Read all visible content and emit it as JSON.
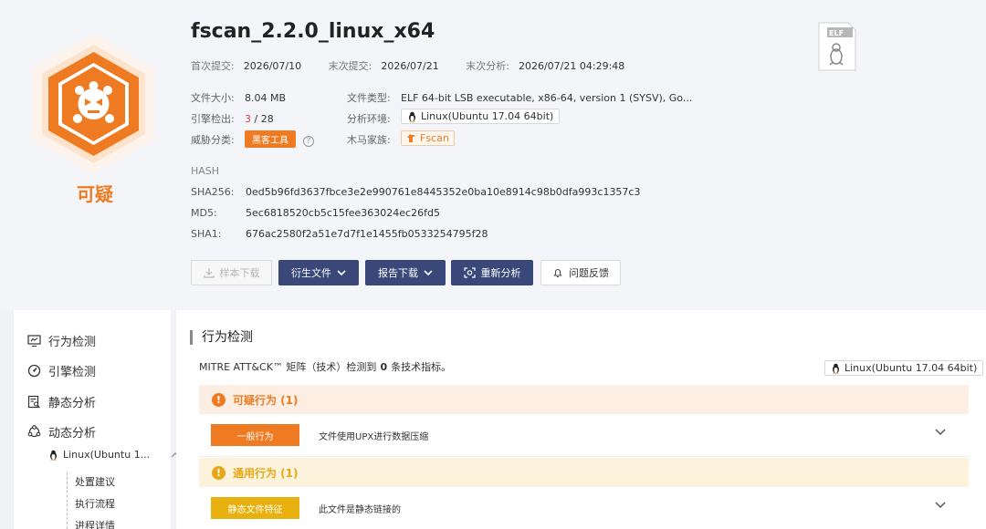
{
  "verdict": {
    "label": "可疑",
    "color": "#ee7b22"
  },
  "file": {
    "name": "fscan_2.2.0_linux_x64",
    "dates": [
      {
        "label": "首次提交:",
        "value": "2026/07/10"
      },
      {
        "label": "末次提交:",
        "value": "2026/07/21"
      },
      {
        "label": "末次分析:",
        "value": "2026/07/21 04:29:48"
      }
    ],
    "size_label": "文件大小:",
    "size": "8.04 MB",
    "engine_label": "引擎检出:",
    "engine_hits": "3",
    "engine_total": "/ 28",
    "threat_label": "威胁分类:",
    "threat_tag": "黑客工具",
    "type_label": "文件类型:",
    "type": "ELF 64-bit LSB executable, x86-64, version 1 (SYSV), Go...",
    "env_label": "分析环境:",
    "env": "Linux(Ubuntu 17.04 64bit)",
    "family_label": "木马家族:",
    "family": "Fscan",
    "filetype_icon_text": "ELF"
  },
  "hash": {
    "heading": "HASH",
    "items": [
      {
        "label": "SHA256:",
        "value": "0ed5b96fd3637fbce3e2e990761e8445352e0ba10e8914c98b0dfa993c1357c3"
      },
      {
        "label": "MD5:",
        "value": "5ec6818520cb5c15fee363024ec26fd5"
      },
      {
        "label": "SHA1:",
        "value": "676ac2580f2a51e7d7f1e1455fb0533254795f28"
      }
    ]
  },
  "actions": {
    "download": "样本下载",
    "derived": "衍生文件",
    "report": "报告下载",
    "reanalyze": "重新分析",
    "feedback": "问题反馈"
  },
  "sidebar": {
    "items": [
      {
        "label": "行为检测",
        "icon": "monitor-icon"
      },
      {
        "label": "引擎检测",
        "icon": "gauge-icon"
      },
      {
        "label": "静态分析",
        "icon": "document-search-icon"
      },
      {
        "label": "动态分析",
        "icon": "cycle-icon"
      }
    ],
    "sub": {
      "label": "Linux(Ubuntu 1...",
      "icon": "linux-icon"
    },
    "leaves": [
      "处置建议",
      "执行流程",
      "进程详情"
    ]
  },
  "main": {
    "section_title": "行为检测",
    "mitre_prefix": "MITRE ATT&CK™ 矩阵（技术）检测到",
    "mitre_count": "0",
    "mitre_suffix": "条技术指标。",
    "env_tag": "Linux(Ubuntu 17.04 64bit)",
    "groups": [
      {
        "title": "可疑行为 (1)",
        "bg": "#fdeee3",
        "color": "#ee7b22",
        "row": {
          "tag": "一般行为",
          "tag_color": "#ee7b22",
          "desc": "文件使用UPX进行数据压缩"
        }
      },
      {
        "title": "通用行为 (1)",
        "bg": "#fdf3dc",
        "color": "#e6a817",
        "row": {
          "tag": "静态文件特征",
          "tag_color": "#e9b10f",
          "desc": "此文件是静态链接的"
        }
      }
    ]
  }
}
